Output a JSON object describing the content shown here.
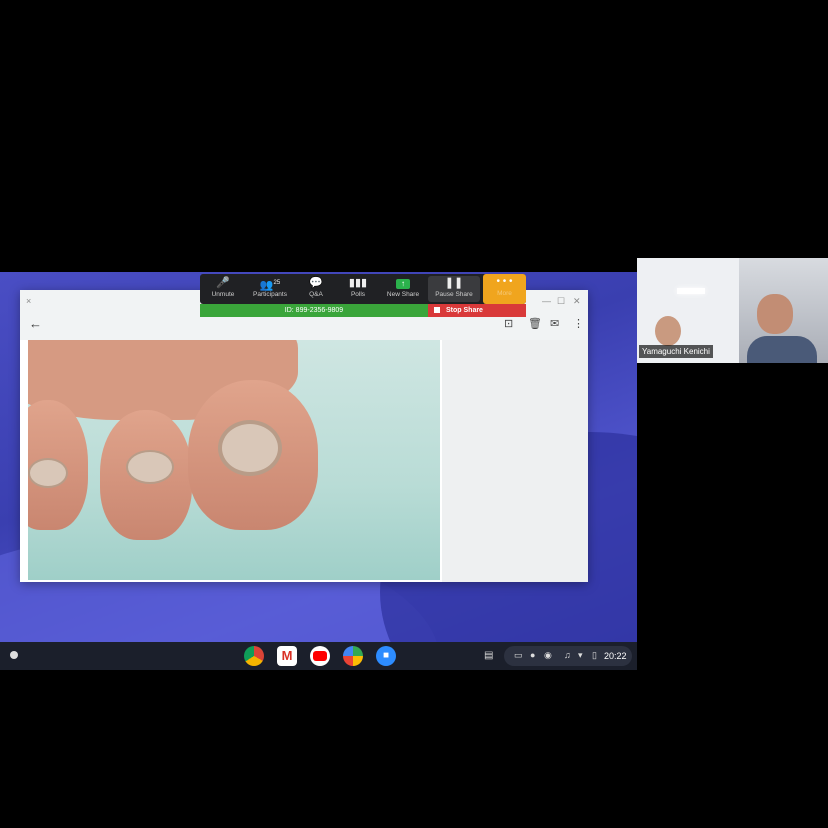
{
  "zoom_toolbar": {
    "buttons": [
      {
        "label": "Unmute",
        "icon": "mic-muted-icon"
      },
      {
        "label": "Participants",
        "icon": "participants-icon",
        "count": "25"
      },
      {
        "label": "Q&A",
        "icon": "qa-icon"
      },
      {
        "label": "Polls",
        "icon": "polls-icon"
      },
      {
        "label": "New Share",
        "icon": "share-up-icon"
      },
      {
        "label": "Pause Share",
        "icon": "pause-icon"
      },
      {
        "label": "More",
        "icon": "more-icon"
      }
    ],
    "meeting_id": "ID: 899-2356-9809",
    "stop_share": "Stop Share"
  },
  "video": {
    "participant_name": "Yamaguchi Kenichi"
  },
  "shelf": {
    "apps": [
      {
        "name": "chrome",
        "icon": "chrome-icon"
      },
      {
        "name": "gmail",
        "icon": "gmail-icon"
      },
      {
        "name": "youtube",
        "icon": "youtube-icon"
      },
      {
        "name": "play-store",
        "icon": "play-store-icon"
      },
      {
        "name": "zoom",
        "icon": "zoom-icon"
      }
    ],
    "time": "20:22"
  },
  "colors": {
    "toolbar_bg": "#202124",
    "more_button": "#f0a51e",
    "meeting_bar": "#3aa53a",
    "stop_share": "#d93939",
    "desktop": "#4a4ec4"
  }
}
